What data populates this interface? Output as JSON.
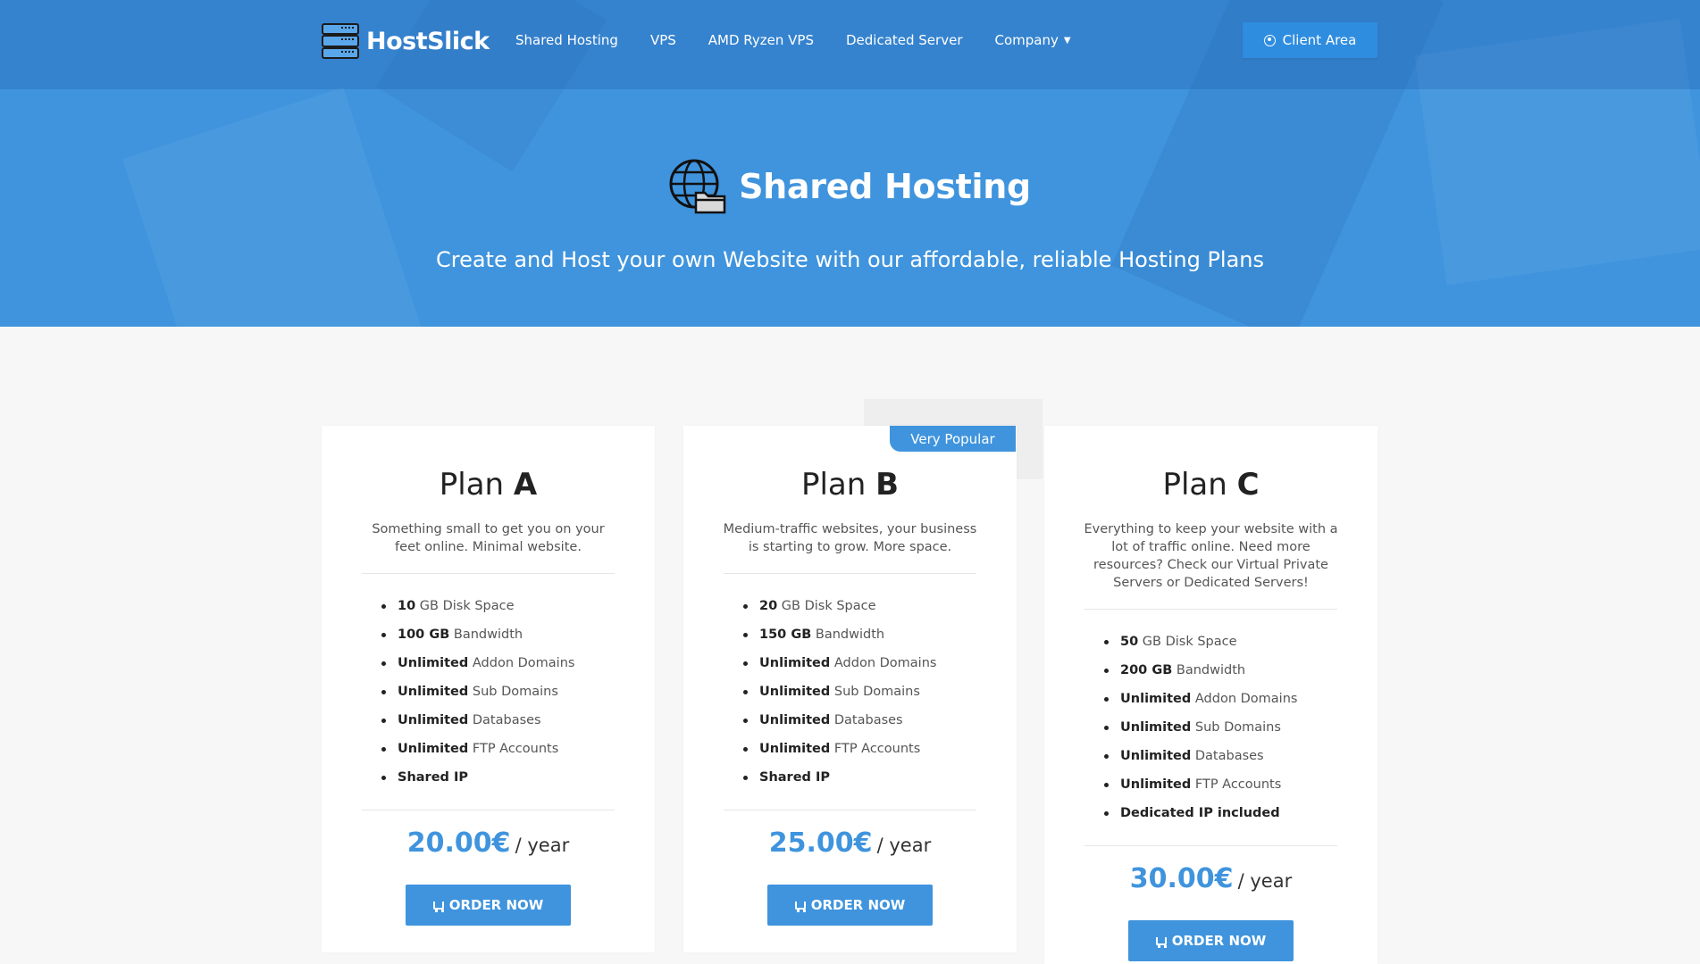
{
  "header": {
    "brand": "HostSlick",
    "nav": [
      {
        "label": "Shared Hosting"
      },
      {
        "label": "VPS"
      },
      {
        "label": "AMD Ryzen VPS"
      },
      {
        "label": "Dedicated Server"
      },
      {
        "label": "Company"
      }
    ],
    "client_area": "Client Area"
  },
  "hero": {
    "title": "Shared Hosting",
    "subtitle": "Create and Host your own Website with our affordable, reliable Hosting Plans"
  },
  "badge": "Very Popular",
  "plans": [
    {
      "name_prefix": "Plan",
      "name_letter": "A",
      "description": "Something small to get you on your feet online. Minimal website.",
      "features": [
        {
          "bold": "10",
          "text": " GB Disk Space"
        },
        {
          "bold": "100 GB",
          "text": " Bandwidth"
        },
        {
          "bold": "Unlimited",
          "text": " Addon Domains"
        },
        {
          "bold": "Unlimited",
          "text": " Sub Domains"
        },
        {
          "bold": "Unlimited",
          "text": " Databases"
        },
        {
          "bold": "Unlimited",
          "text": " FTP Accounts"
        },
        {
          "bold": "Shared IP",
          "text": ""
        }
      ],
      "price": "20.00€",
      "period": "/ year",
      "order_label": "ORDER NOW"
    },
    {
      "name_prefix": "Plan",
      "name_letter": "B",
      "description": "Medium-traffic websites, your business is starting to grow. More space.",
      "features": [
        {
          "bold": "20",
          "text": " GB Disk Space"
        },
        {
          "bold": "150 GB",
          "text": " Bandwidth"
        },
        {
          "bold": "Unlimited",
          "text": " Addon Domains"
        },
        {
          "bold": "Unlimited",
          "text": " Sub Domains"
        },
        {
          "bold": "Unlimited",
          "text": " Databases"
        },
        {
          "bold": "Unlimited",
          "text": " FTP Accounts"
        },
        {
          "bold": "Shared IP",
          "text": ""
        }
      ],
      "price": "25.00€",
      "period": "/ year",
      "order_label": "ORDER NOW"
    },
    {
      "name_prefix": "Plan",
      "name_letter": "C",
      "description": "Everything to keep your website with a lot of traffic online. Need more resources? Check our Virtual Private Servers or Dedicated Servers!",
      "features": [
        {
          "bold": "50",
          "text": " GB Disk Space"
        },
        {
          "bold": "200 GB",
          "text": " Bandwidth"
        },
        {
          "bold": "Unlimited",
          "text": " Addon Domains"
        },
        {
          "bold": "Unlimited",
          "text": " Sub Domains"
        },
        {
          "bold": "Unlimited",
          "text": " Databases"
        },
        {
          "bold": "Unlimited",
          "text": " FTP Accounts"
        },
        {
          "bold": "Dedicated IP included",
          "text": ""
        }
      ],
      "price": "30.00€",
      "period": "/ year",
      "order_label": "ORDER NOW"
    }
  ],
  "icons": {
    "logo": "server-stack-icon",
    "hero": "globe-folder-icon",
    "client": "user-circle-icon",
    "dropdown": "caret-down-icon",
    "order": "cart-icon"
  },
  "colors": {
    "accent": "#3f94dd",
    "hero_bg": "#3f94dd",
    "page_bg": "#f7f7f7",
    "card_bg": "#ffffff"
  }
}
